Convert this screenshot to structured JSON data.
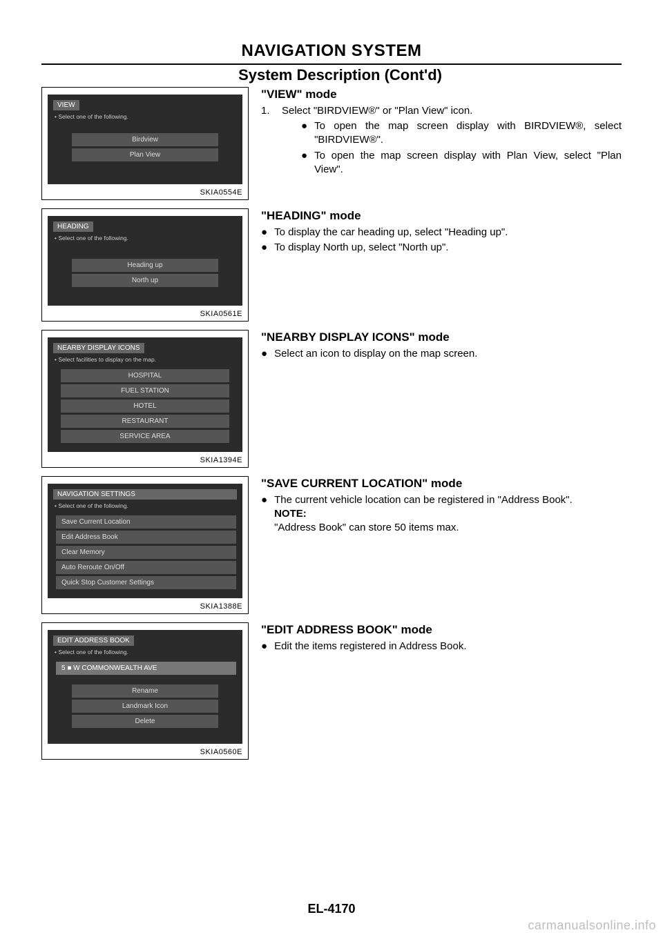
{
  "header": {
    "title": "NAVIGATION SYSTEM",
    "subtitle": "System Description (Cont'd)"
  },
  "sections": [
    {
      "figure": {
        "id": "SKIA0554E",
        "title": "VIEW",
        "hint": "• Select one of the following.",
        "items": [
          "Birdview",
          "Plan View"
        ]
      },
      "mode_title": "\"VIEW\" mode",
      "ordered": [
        {
          "num": "1.",
          "text": "Select \"BIRDVIEW®\" or \"Plan View\" icon.",
          "bullets": [
            "To open the map screen display with BIRDVIEW®, select \"BIRDVIEW®\".",
            "To open the map screen display with Plan View, select \"Plan View\"."
          ]
        }
      ]
    },
    {
      "figure": {
        "id": "SKIA0561E",
        "title": "HEADING",
        "hint": "• Select one of the following.",
        "items": [
          "Heading up",
          "North up"
        ]
      },
      "mode_title": "\"HEADING\" mode",
      "bullets": [
        "To display the car heading up, select \"Heading up\".",
        "To display North up, select \"North up\"."
      ]
    },
    {
      "figure": {
        "id": "SKIA1394E",
        "title": "NEARBY DISPLAY ICONS",
        "hint": "• Select facilities to display on the map.",
        "items": [
          "HOSPITAL",
          "FUEL STATION",
          "HOTEL",
          "RESTAURANT",
          "SERVICE AREA"
        ]
      },
      "mode_title": "\"NEARBY DISPLAY ICONS\" mode",
      "bullets": [
        "Select an icon to display on the map screen."
      ]
    },
    {
      "figure": {
        "id": "SKIA1388E",
        "title": "NAVIGATION SETTINGS",
        "hint": "• Select one of the following.",
        "items": [
          "Save Current Location",
          "Edit Address Book",
          "Clear Memory",
          "Auto Reroute On/Off",
          "Quick Stop Customer Settings"
        ]
      },
      "mode_title": "\"SAVE CURRENT LOCATION\" mode",
      "bullets": [
        "The current vehicle location can be registered in \"Address Book\"."
      ],
      "note_label": "NOTE:",
      "note_text": "\"Address Book\" can store 50 items max."
    },
    {
      "figure": {
        "id": "SKIA0560E",
        "title": "EDIT ADDRESS BOOK",
        "hint": "• Select one of the following.",
        "top_row": "5   ■   W COMMONWEALTH AVE",
        "items": [
          "Rename",
          "Landmark Icon",
          "Delete"
        ]
      },
      "mode_title": "\"EDIT ADDRESS BOOK\" mode",
      "bullets": [
        "Edit the items registered in Address Book."
      ]
    }
  ],
  "footer": "EL-4170",
  "watermark": "carmanualsonline.info"
}
